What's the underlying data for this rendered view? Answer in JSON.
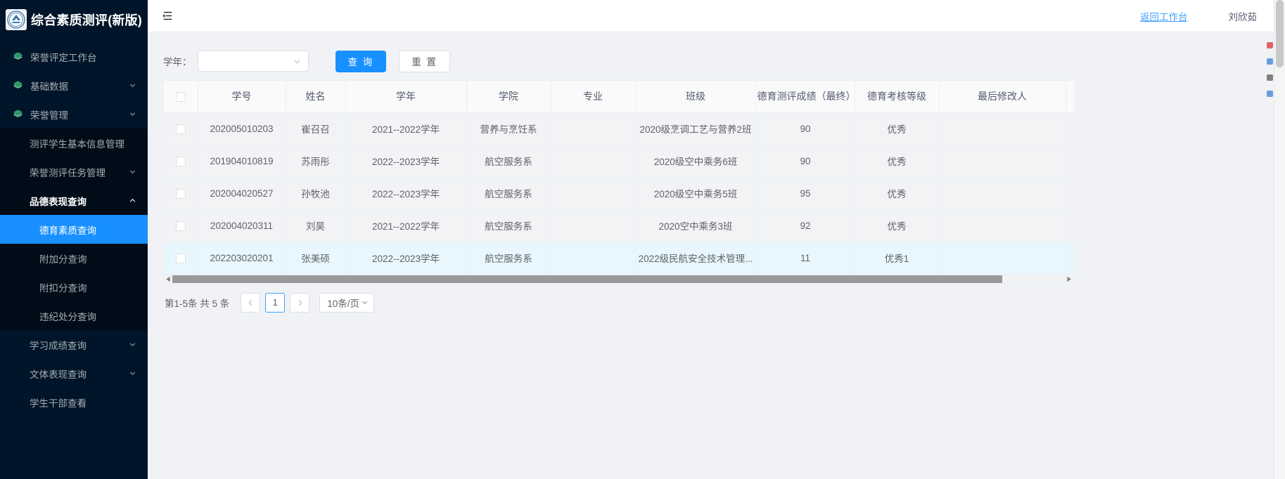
{
  "brand": {
    "title": "综合素质测评(新版)",
    "logo_icon": "university-emblem-icon"
  },
  "sidebar": {
    "items": [
      {
        "label": "荣誉评定工作台",
        "icon": "layers-icon",
        "level": 0,
        "has_arrow": false,
        "state": "normal"
      },
      {
        "label": "基础数据",
        "icon": "layers-icon",
        "level": 0,
        "has_arrow": true,
        "arrow": "chevron-down-icon",
        "state": "normal"
      },
      {
        "label": "荣誉管理",
        "icon": "layers-icon",
        "level": 0,
        "has_arrow": true,
        "arrow": "chevron-down-icon",
        "state": "normal"
      },
      {
        "label": "测评学生基本信息管理",
        "level": 1,
        "has_arrow": false,
        "state": "normal"
      },
      {
        "label": "荣誉测评任务管理",
        "level": 1,
        "has_arrow": true,
        "arrow": "chevron-down-icon",
        "state": "normal"
      },
      {
        "label": "品德表现查询",
        "level": 1,
        "has_arrow": true,
        "arrow": "chevron-up-icon",
        "state": "expanded"
      },
      {
        "label": "德育素质查询",
        "level": 2,
        "has_arrow": false,
        "state": "active"
      },
      {
        "label": "附加分查询",
        "level": 2,
        "has_arrow": false,
        "state": "normal"
      },
      {
        "label": "附扣分查询",
        "level": 2,
        "has_arrow": false,
        "state": "normal"
      },
      {
        "label": "违纪处分查询",
        "level": 2,
        "has_arrow": false,
        "state": "normal"
      },
      {
        "label": "学习成绩查询",
        "level": 1,
        "has_arrow": true,
        "arrow": "chevron-down-icon",
        "state": "normal"
      },
      {
        "label": "文体表现查询",
        "level": 1,
        "has_arrow": true,
        "arrow": "chevron-down-icon",
        "state": "normal"
      },
      {
        "label": "学生干部查看",
        "level": 1,
        "has_arrow": false,
        "state": "normal"
      }
    ]
  },
  "topbar": {
    "collapse_icon": "menu-fold-icon",
    "back_link": "返回工作台",
    "user_name": "刘欣茹"
  },
  "filter": {
    "year_label": "学年：",
    "year_value": "",
    "year_placeholder": "",
    "caret_icon": "chevron-down-icon",
    "search_button": "查 询",
    "reset_button": "重 置"
  },
  "table": {
    "select_all_checkbox": "unchecked",
    "columns": [
      "学号",
      "姓名",
      "学年",
      "学院",
      "专业",
      "班级",
      "德育测评成绩（最终）",
      "德育考核等级",
      "最后修改人"
    ],
    "rows": [
      {
        "checked": false,
        "highlight": false,
        "student_id": "202005010203",
        "name": "崔召召",
        "school_year": "2021--2022学年",
        "college": "营养与烹饪系",
        "major": "",
        "class": "2020级烹调工艺与营养2班",
        "score": "90",
        "grade": "优秀",
        "last_editor": ""
      },
      {
        "checked": false,
        "highlight": false,
        "student_id": "201904010819",
        "name": "苏雨彤",
        "school_year": "2022--2023学年",
        "college": "航空服务系",
        "major": "",
        "class": "2020级空中乘务6班",
        "score": "90",
        "grade": "优秀",
        "last_editor": ""
      },
      {
        "checked": false,
        "highlight": false,
        "student_id": "202004020527",
        "name": "孙牧池",
        "school_year": "2022--2023学年",
        "college": "航空服务系",
        "major": "",
        "class": "2020级空中乘务5班",
        "score": "95",
        "grade": "优秀",
        "last_editor": ""
      },
      {
        "checked": false,
        "highlight": false,
        "student_id": "202004020311",
        "name": "刘昊",
        "school_year": "2021--2022学年",
        "college": "航空服务系",
        "major": "",
        "class": "2020空中乘务3班",
        "score": "92",
        "grade": "优秀",
        "last_editor": ""
      },
      {
        "checked": false,
        "highlight": true,
        "student_id": "202203020201",
        "name": "张美硕",
        "school_year": "2022--2023学年",
        "college": "航空服务系",
        "major": "",
        "class": "2022级民航安全技术管理...",
        "score": "11",
        "grade": "优秀1",
        "last_editor": ""
      }
    ],
    "hscroll": {
      "left_arrow_icon": "triangle-left-icon",
      "right_arrow_icon": "triangle-right-icon"
    }
  },
  "pagination": {
    "total_text": "第1-5条 共 5 条",
    "prev_icon": "chevron-left-icon",
    "next_icon": "chevron-right-icon",
    "current_page": "1",
    "page_size": "10条/页",
    "page_size_caret": "chevron-down-icon"
  },
  "colors": {
    "sidebar_bg": "#001529",
    "sidebar_sub_bg": "#000c17",
    "accent": "#1890ff",
    "link": "#409eff",
    "row_highlight": "#e8f7fd",
    "table_row_bg": "#f2f3f5",
    "header_bg": "#fafafa"
  }
}
